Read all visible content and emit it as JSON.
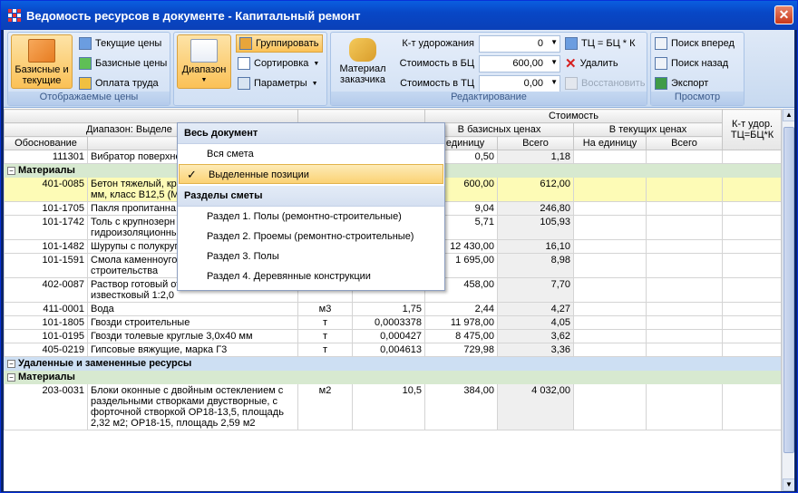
{
  "window": {
    "title": "Ведомость ресурсов в документе - Капитальный ремонт",
    "close": "✕"
  },
  "ribbon": {
    "shown_prices": {
      "big_button": "Базисные и текущие",
      "current": "Текущие цены",
      "base": "Базисные цены",
      "labor": "Оплата труда",
      "caption": "Отображаемые цены"
    },
    "range": {
      "big_button": "Диапазон",
      "group": "Группировать",
      "sort": "Сортировка",
      "params": "Параметры"
    },
    "edit": {
      "material_btn": "Материал заказчика",
      "k_label": "К-т удорожания",
      "k_value": "0",
      "base_label": "Стоимость в БЦ",
      "base_value": "600,00",
      "cur_label": "Стоимость в ТЦ",
      "cur_value": "0,00",
      "formula": "ТЦ = БЦ * К",
      "delete": "Удалить",
      "restore": "Восстановить",
      "caption": "Редактирование"
    },
    "view": {
      "next": "Поиск вперед",
      "prev": "Поиск назад",
      "export": "Экспорт",
      "caption": "Просмотр"
    }
  },
  "menu": {
    "whole_header": "Весь документ",
    "items_top": [
      "Вся смета",
      "Выделенные позиции"
    ],
    "sections_header": "Разделы сметы",
    "sections": [
      "Раздел 1. Полы (ремонтно-строительные)",
      "Раздел 2. Проемы (ремонтно-строительные)",
      "Раздел 3. Полы",
      "Раздел 4. Деревянные конструкции"
    ]
  },
  "grid": {
    "range_label": "Диапазон: Выделе",
    "headers": {
      "cost": "Стоимость",
      "k": "К-т удор. ТЦ=БЦ*К",
      "base": "В базисных ценах",
      "cur": "В текущих ценах",
      "code": "Обоснование",
      "name": "Наи",
      "unit_price": "а единицу",
      "total": "Всего",
      "cur_unit": "На единицу",
      "cur_total": "Всего"
    },
    "rows": [
      {
        "type": "item",
        "code": "111301",
        "name": "Вибратор поверхно",
        "unit": "",
        "qty": "",
        "price": "0,50",
        "total": "1,18"
      },
      {
        "type": "sub",
        "label": "Материалы"
      },
      {
        "type": "item",
        "sel": true,
        "code": "401-0085",
        "name": "Бетон тяжелый, кр\nмм, класс В12,5 (М1",
        "unit": "",
        "qty": "",
        "price": "600,00",
        "total": "612,00"
      },
      {
        "type": "item",
        "code": "101-1705",
        "name": "Пакля пропитанна",
        "unit": "",
        "qty": "",
        "price": "9,04",
        "total": "246,80"
      },
      {
        "type": "item",
        "code": "101-1742",
        "name": "Толь с крупнозерн\nгидроизоляционны",
        "unit": "",
        "qty": "",
        "price": "5,71",
        "total": "105,93"
      },
      {
        "type": "item",
        "code": "101-1482",
        "name": "Шурупы с полукруглой головкой 5х70 мм",
        "unit": "т",
        "qty": "0,001295",
        "price": "12 430,00",
        "total": "16,10"
      },
      {
        "type": "item",
        "code": "101-1591",
        "name": "Смола каменноугольная для дорожного\nстроительства",
        "unit": "т",
        "qty": "0,005299",
        "price": "1 695,00",
        "total": "8,98"
      },
      {
        "type": "item",
        "code": "402-0087",
        "name": "Раствор готовый отделочный тяжелый,\nизвестковый 1:2,0",
        "unit": "м3",
        "qty": "0,0168",
        "price": "458,00",
        "total": "7,70"
      },
      {
        "type": "item",
        "code": "411-0001",
        "name": "Вода",
        "unit": "м3",
        "qty": "1,75",
        "price": "2,44",
        "total": "4,27"
      },
      {
        "type": "item",
        "code": "101-1805",
        "name": "Гвозди строительные",
        "unit": "т",
        "qty": "0,0003378",
        "price": "11 978,00",
        "total": "4,05"
      },
      {
        "type": "item",
        "code": "101-0195",
        "name": "Гвозди толевые круглые 3,0х40 мм",
        "unit": "т",
        "qty": "0,000427",
        "price": "8 475,00",
        "total": "3,62"
      },
      {
        "type": "item",
        "code": "405-0219",
        "name": "Гипсовые вяжущие, марка Г3",
        "unit": "т",
        "qty": "0,004613",
        "price": "729,98",
        "total": "3,36"
      },
      {
        "type": "grp",
        "label": "Удаленные и замененные ресурсы"
      },
      {
        "type": "sub",
        "label": "Материалы"
      },
      {
        "type": "item",
        "code": "203-0031",
        "name": "Блоки оконные с двойным остеклением с\nраздельными створками двустворные, с\nфорточной створкой ОР18-13,5, площадь\n2,32 м2; ОР18-15, площадь 2,59 м2",
        "unit": "м2",
        "qty": "10,5",
        "price": "384,00",
        "total": "4 032,00"
      }
    ]
  }
}
